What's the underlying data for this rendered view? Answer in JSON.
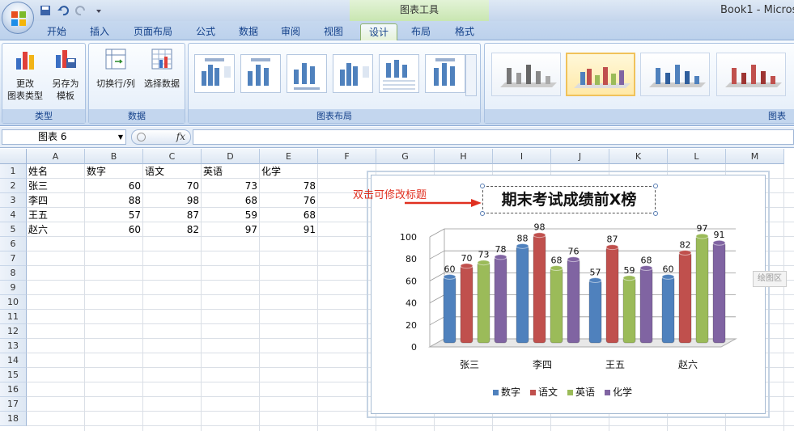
{
  "app": {
    "context_title": "图表工具",
    "book_title": "Book1 - Micros",
    "accent": "#8db26c"
  },
  "tabs": [
    "开始",
    "插入",
    "页面布局",
    "公式",
    "数据",
    "审阅",
    "视图",
    "设计",
    "布局",
    "格式"
  ],
  "active_tab": "设计",
  "ribbon": {
    "group_type": {
      "label": "类型",
      "buttons": [
        "更改\n图表类型",
        "另存为\n模板"
      ]
    },
    "group_data": {
      "label": "数据",
      "buttons": [
        "切换行/列",
        "选择数据"
      ]
    },
    "group_layout": {
      "label": "图表布局"
    },
    "group_styles": {
      "label": "图表"
    }
  },
  "formula": {
    "name_box": "图表 6",
    "fx": "fx",
    "value": ""
  },
  "columns": [
    "A",
    "B",
    "C",
    "D",
    "E",
    "F",
    "G",
    "H",
    "I",
    "J",
    "K",
    "L",
    "M"
  ],
  "rows": [
    "1",
    "2",
    "3",
    "4",
    "5",
    "6",
    "7",
    "8",
    "9",
    "10",
    "11",
    "12",
    "13",
    "14",
    "15",
    "16",
    "17",
    "18"
  ],
  "sheet": {
    "header": [
      "姓名",
      "数字",
      "语文",
      "英语",
      "化学"
    ],
    "data": [
      [
        "张三",
        "60",
        "70",
        "73",
        "78"
      ],
      [
        "李四",
        "88",
        "98",
        "68",
        "76"
      ],
      [
        "王五",
        "57",
        "87",
        "59",
        "68"
      ],
      [
        "赵六",
        "60",
        "82",
        "97",
        "91"
      ]
    ]
  },
  "annotation": "双击可修改标题",
  "side_label": "绘图区",
  "chart_data": {
    "type": "bar",
    "title": "期末考试成绩前X榜",
    "categories": [
      "张三",
      "李四",
      "王五",
      "赵六"
    ],
    "series": [
      {
        "name": "数字",
        "values": [
          60,
          88,
          57,
          60
        ],
        "color": "#4f81bd"
      },
      {
        "name": "语文",
        "values": [
          70,
          98,
          87,
          82
        ],
        "color": "#c0504d"
      },
      {
        "name": "英语",
        "values": [
          73,
          68,
          59,
          97
        ],
        "color": "#9bbb59"
      },
      {
        "name": "化学",
        "values": [
          78,
          76,
          68,
          91
        ],
        "color": "#8064a2"
      }
    ],
    "yticks": [
      "0",
      "20",
      "40",
      "60",
      "80",
      "100"
    ],
    "ylim": [
      0,
      100
    ],
    "legend": "bottom",
    "grid": true
  }
}
